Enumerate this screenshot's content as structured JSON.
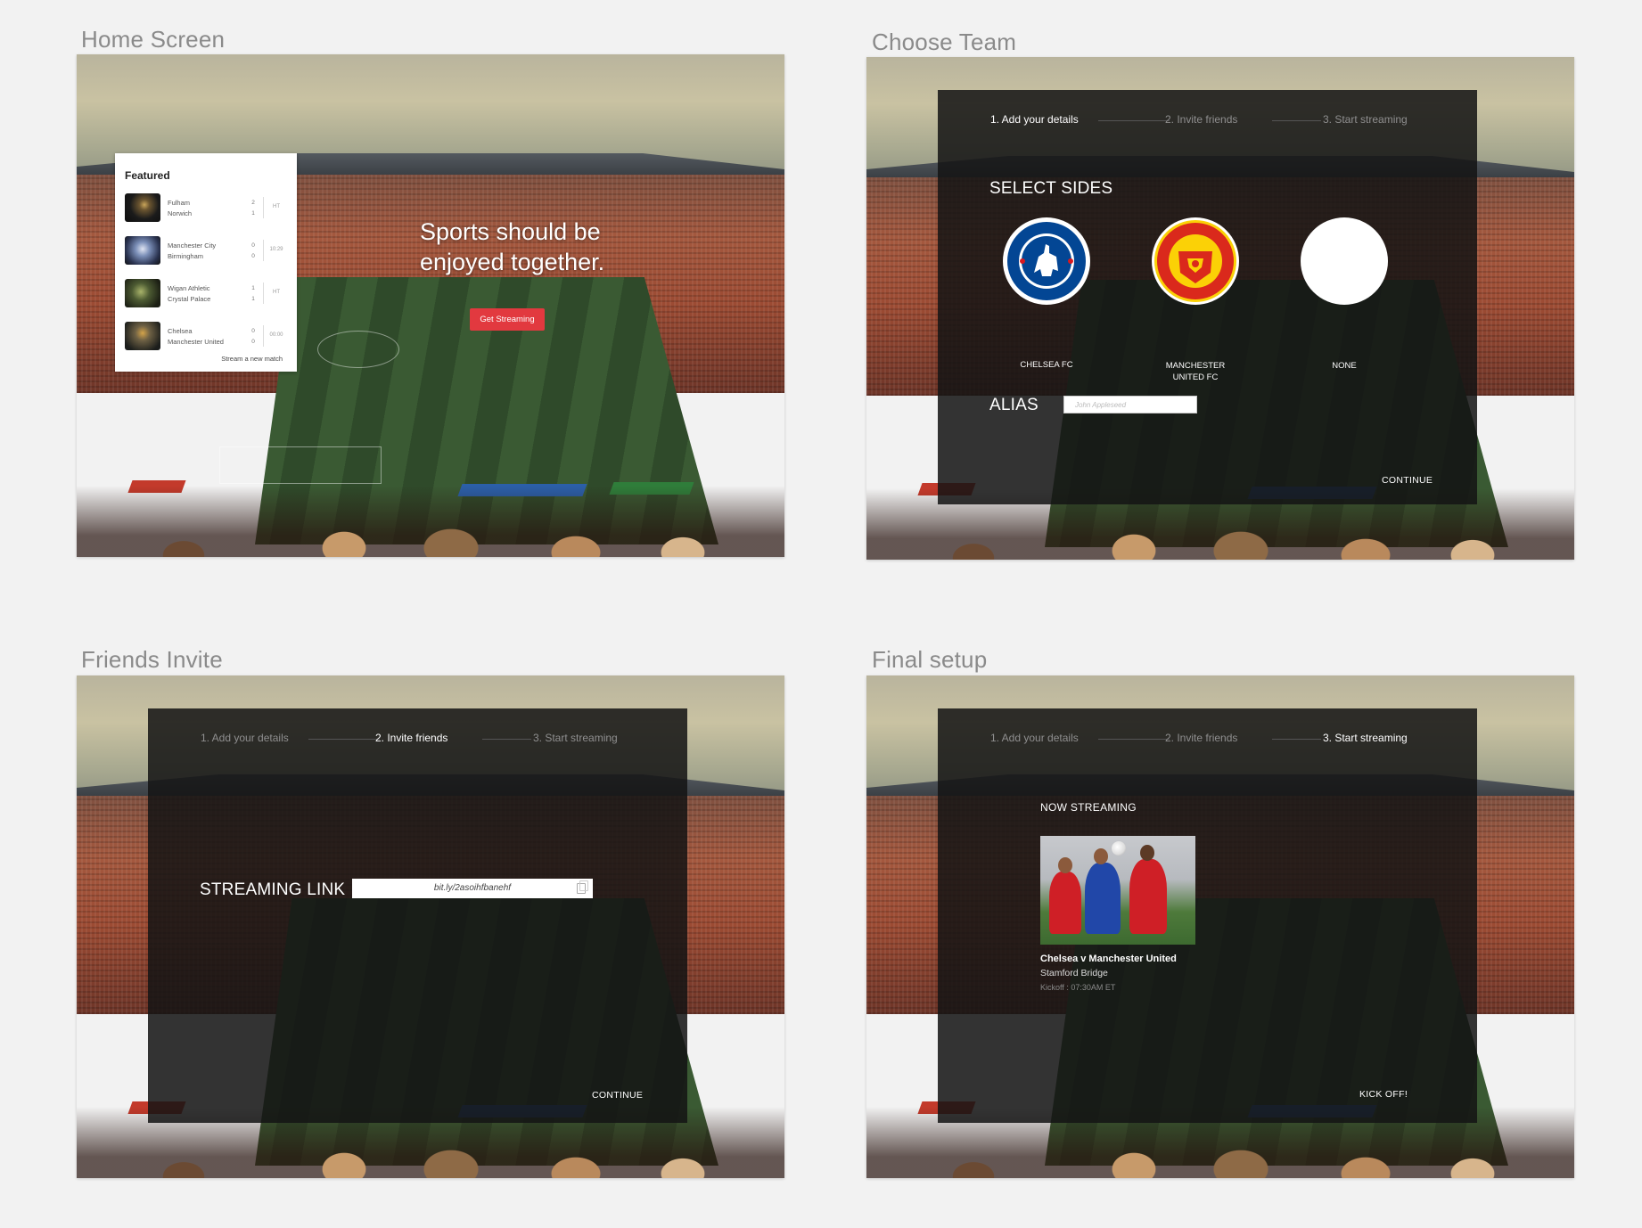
{
  "boards": {
    "home": {
      "title": "Home Screen"
    },
    "choose_team": {
      "title": "Choose Team"
    },
    "friends_invite": {
      "title": "Friends Invite"
    },
    "final_setup": {
      "title": "Final setup"
    }
  },
  "home": {
    "featured_title": "Featured",
    "matches": [
      {
        "home": "Fulham",
        "away": "Norwich",
        "home_score": "2",
        "away_score": "1",
        "time": "HT"
      },
      {
        "home": "Manchester City",
        "away": "Birmingham",
        "home_score": "0",
        "away_score": "0",
        "time": "10:29"
      },
      {
        "home": "Wigan Athletic",
        "away": "Crystal Palace",
        "home_score": "1",
        "away_score": "1",
        "time": "HT"
      },
      {
        "home": "Chelsea",
        "away": "Manchester United",
        "home_score": "0",
        "away_score": "0",
        "time": "00:00"
      }
    ],
    "stream_new_link": "Stream a new match",
    "headline_line1": "Sports should be",
    "headline_line2": "enjoyed together.",
    "cta": "Get Streaming",
    "cta_color": "#e2393f"
  },
  "steps": {
    "step1": "1. Add your details",
    "step2": "2. Invite friends",
    "step3": "3. Start streaming"
  },
  "choose_team": {
    "section_label": "SELECT SIDES",
    "teams": [
      {
        "name": "CHELSEA FC",
        "icon": "chelsea-crest-icon"
      },
      {
        "name_line1": "MANCHESTER",
        "name_line2": "UNITED FC",
        "icon": "manchester-united-crest-icon"
      },
      {
        "name": "NONE",
        "icon": "none-circle-icon"
      }
    ],
    "alias_label": "ALIAS",
    "alias_placeholder": "John Appleseed",
    "continue": "CONTINUE"
  },
  "friends_invite": {
    "streaming_link_label": "STREAMING LINK",
    "streaming_link_value": "bit.ly/2asoihfbanehf",
    "continue": "CONTINUE"
  },
  "final_setup": {
    "now_streaming": "NOW STREAMING",
    "match_title": "Chelsea v Manchester United",
    "venue": "Stamford Bridge",
    "kickoff": "Kickoff : 07:30AM ET",
    "cta": "KICK OFF!"
  },
  "colors": {
    "background": "#f2f2f2",
    "panel": "#141414",
    "accent_red": "#e2393f",
    "chelsea_blue": "#034694",
    "united_red": "#da291c"
  }
}
